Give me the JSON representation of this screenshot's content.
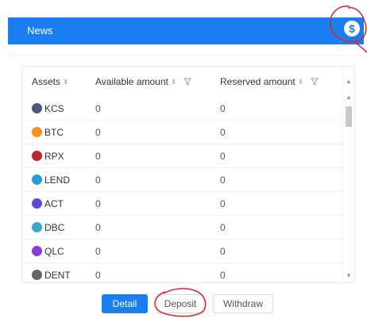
{
  "header": {
    "title": "News",
    "coin_icon": "dollar-coin-icon",
    "coin_glyph": "$"
  },
  "table": {
    "columns": [
      {
        "label": "Assets",
        "sort": true,
        "filter": false
      },
      {
        "label": "Available amount",
        "sort": true,
        "filter": true
      },
      {
        "label": "Reserved amount",
        "sort": true,
        "filter": true
      }
    ],
    "rows": [
      {
        "symbol": "KCS",
        "icon": "kcs-icon",
        "color": "#4a5a78",
        "available": "0",
        "reserved": "0"
      },
      {
        "symbol": "BTC",
        "icon": "btc-icon",
        "color": "#f7931a",
        "available": "0",
        "reserved": "0"
      },
      {
        "symbol": "RPX",
        "icon": "rpx-icon",
        "color": "#c0262d",
        "available": "0",
        "reserved": "0"
      },
      {
        "symbol": "LEND",
        "icon": "lend-icon",
        "color": "#2a9bd6",
        "available": "0",
        "reserved": "0"
      },
      {
        "symbol": "ACT",
        "icon": "act-icon",
        "color": "#5b4ad6",
        "available": "0",
        "reserved": "0"
      },
      {
        "symbol": "DBC",
        "icon": "dbc-icon",
        "color": "#3aa7c9",
        "available": "0",
        "reserved": "0"
      },
      {
        "symbol": "QLC",
        "icon": "qlc-icon",
        "color": "#8a3ad6",
        "available": "0",
        "reserved": "0"
      },
      {
        "symbol": "DENT",
        "icon": "dent-icon",
        "color": "#666666",
        "available": "0",
        "reserved": "0"
      }
    ]
  },
  "buttons": {
    "detail": "Detail",
    "deposit": "Deposit",
    "withdraw": "Withdraw"
  },
  "colors": {
    "accent": "#1a7ef0",
    "annotation": "#e0202a"
  }
}
